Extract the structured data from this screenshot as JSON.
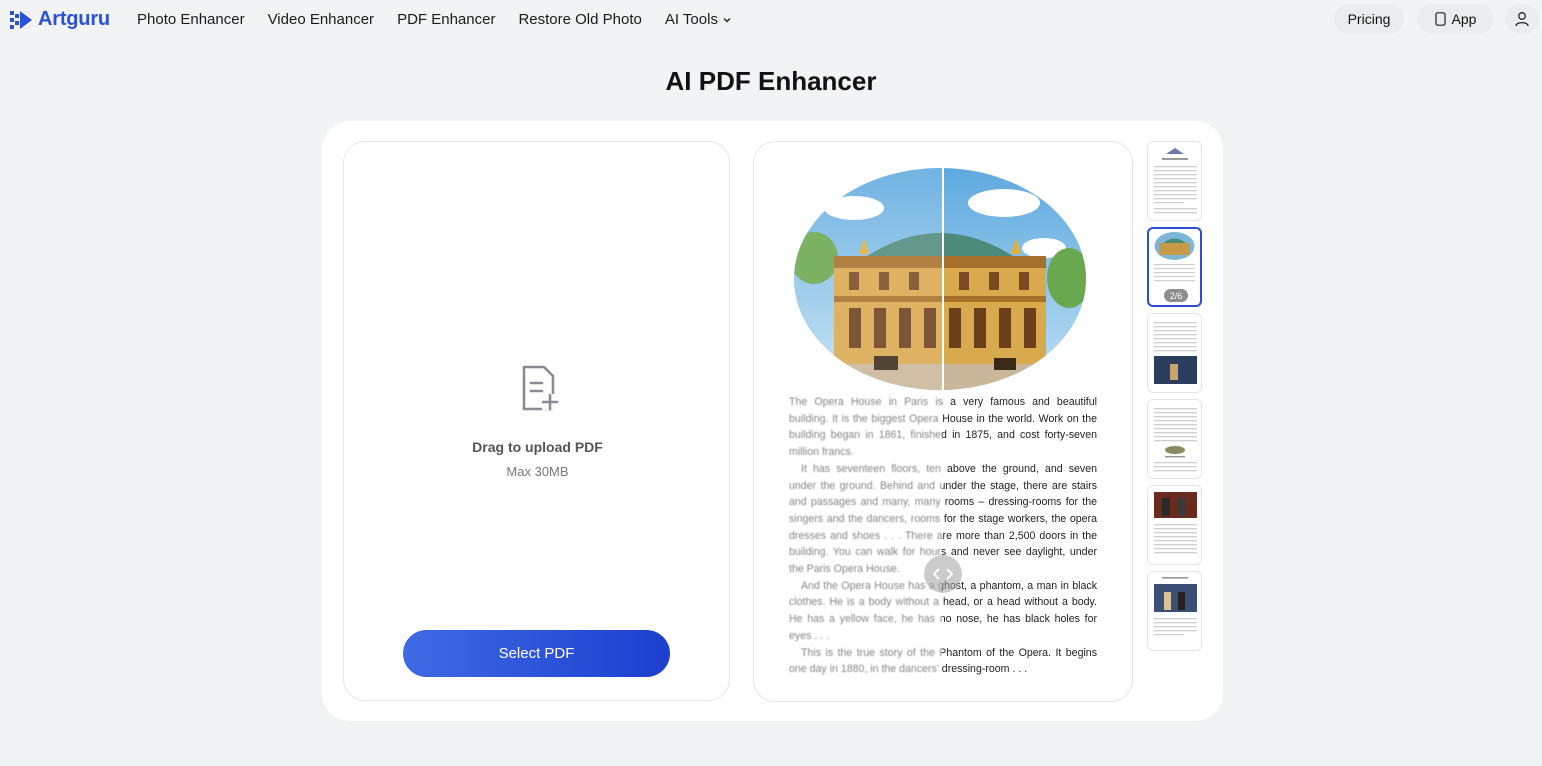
{
  "brand": {
    "name": "Artguru",
    "color": "#2a52d6"
  },
  "nav": {
    "links": [
      {
        "label": "Photo Enhancer"
      },
      {
        "label": "Video Enhancer"
      },
      {
        "label": "PDF Enhancer"
      },
      {
        "label": "Restore Old Photo"
      },
      {
        "label": "AI Tools",
        "icon": "chevron-down-icon"
      }
    ],
    "pricing_label": "Pricing",
    "app_label": "App",
    "app_icon": "phone-icon",
    "user_icon": "user-icon"
  },
  "page": {
    "title": "AI PDF Enhancer"
  },
  "upload": {
    "icon": "document-add-icon",
    "title": "Drag to upload PDF",
    "subtitle": "Max 30MB",
    "button_label": "Select PDF"
  },
  "preview": {
    "paragraphs": [
      "The Opera House in Paris is a very famous and beautiful building. It is the biggest Opera House in the world. Work on the building began in 1861, finished in 1875, and cost forty-seven million francs.",
      "It has seventeen floors, ten above the ground, and seven under the ground. Behind and under the stage, there are stairs and passages and many, many rooms – dressing-rooms for the singers and the dancers, rooms for the stage workers, the opera dresses and shoes . . . There are more than 2,500 doors in the building. You can walk for hours and never see daylight, under the Paris Opera House.",
      "And the Opera House has a ghost, a phantom, a man in black clothes. He is a body without a head, or a head without a body. He has a yellow face, he has no nose, he has black holes for eyes . . .",
      "This is the true story of the Phantom of the Opera. It begins one day in 1880, in the dancers' dressing-room . . ."
    ],
    "compare_handle_icon": "compare-arrows-icon"
  },
  "thumbnails": {
    "active_badge": "2/6",
    "count": 6,
    "active_index": 1
  },
  "colors": {
    "accent": "#2a4fd6",
    "button_gradient_start": "#3f6ae3",
    "button_gradient_end": "#1c3fcf",
    "background": "#f2f3f5"
  }
}
